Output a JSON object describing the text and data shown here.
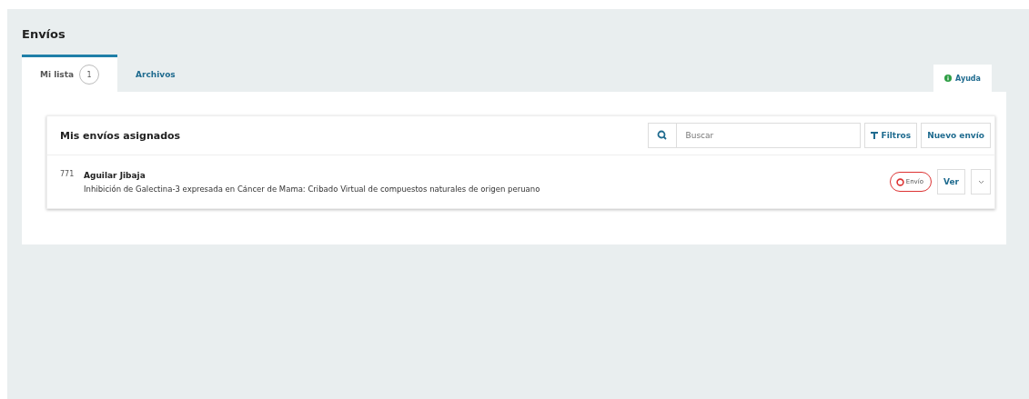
{
  "page_title": "Envíos",
  "tabs": [
    {
      "label": "Mi lista",
      "count": "1",
      "selected": true
    },
    {
      "label": "Archivos",
      "selected": false
    }
  ],
  "help_tab": {
    "label": "Ayuda"
  },
  "list": {
    "title": "Mis envíos asignados",
    "search": {
      "placeholder": "Buscar"
    },
    "buttons": [
      {
        "label": "Filtros",
        "kind": "filter"
      },
      {
        "label": "Nuevo envío",
        "kind": "plain"
      }
    ],
    "items": [
      {
        "id": "771",
        "author": "Aguilar Jibaja",
        "title": "Inhibición de Galectina-3 expresada en Cáncer de Mama: Cribado Virtual de compuestos naturales de origen peruano",
        "stage": "Envío",
        "action": "Ver",
        "expanded": false
      }
    ]
  }
}
